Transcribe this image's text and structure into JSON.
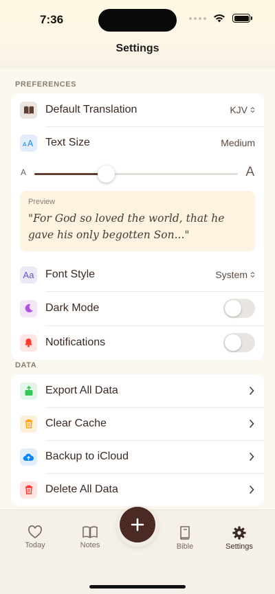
{
  "status": {
    "time": "7:36"
  },
  "nav": {
    "title": "Settings"
  },
  "preferences": {
    "header": "PREFERENCES",
    "translation": {
      "label": "Default Translation",
      "value": "KJV"
    },
    "text_size": {
      "label": "Text Size",
      "value": "Medium",
      "slider_min_label": "A",
      "slider_max_label": "A",
      "level_fraction": 0.35
    },
    "preview": {
      "label": "Preview",
      "text": "\"For God so loved the world, that he gave his only begotten Son...\""
    },
    "font_style": {
      "label": "Font Style",
      "value": "System"
    },
    "dark_mode": {
      "label": "Dark Mode",
      "on": false
    },
    "notifications": {
      "label": "Notifications",
      "on": false
    }
  },
  "data_section": {
    "header": "DATA",
    "items": [
      {
        "label": "Export All Data",
        "icon": "share-icon",
        "color": "#34c759"
      },
      {
        "label": "Clear Cache",
        "icon": "trash-icon",
        "color": "#ff9f0a"
      },
      {
        "label": "Backup to iCloud",
        "icon": "cloud-upload-icon",
        "color": "#0a84ff"
      },
      {
        "label": "Delete All Data",
        "icon": "trash-icon",
        "color": "#ff3b30"
      }
    ]
  },
  "tabbar": {
    "tabs": [
      {
        "label": "Today",
        "icon": "heart-icon"
      },
      {
        "label": "Notes",
        "icon": "book-open-icon"
      },
      {
        "label": "Bible",
        "icon": "book-icon"
      },
      {
        "label": "Settings",
        "icon": "gear-icon"
      }
    ],
    "active": "Settings",
    "fab_icon": "plus-icon"
  },
  "colors": {
    "accent": "#5c3f30",
    "fab": "#4a2a22",
    "preview_bg": "#fdf3e0"
  }
}
